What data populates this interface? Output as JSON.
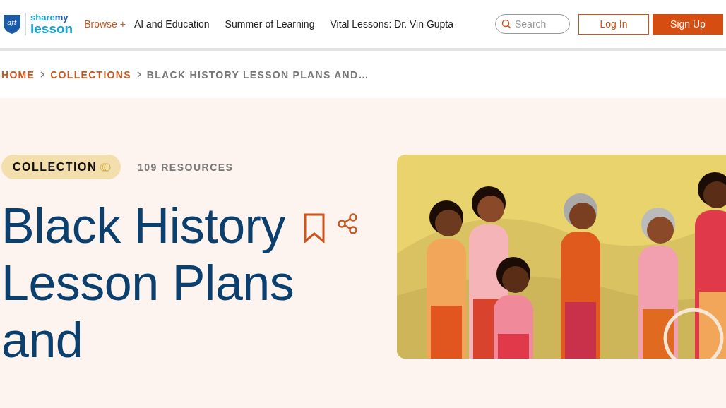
{
  "logo": {
    "line_1": "share",
    "line_1b": "my",
    "line_2": "lesson",
    "badge": "aft"
  },
  "nav": [
    {
      "label": "Browse +",
      "kind": "menu"
    },
    {
      "label": "AI and Education",
      "kind": "link"
    },
    {
      "label": "Summer of Learning",
      "kind": "link"
    },
    {
      "label": "Vital Lessons: Dr. Vin Gupta",
      "kind": "link"
    }
  ],
  "search": {
    "placeholder": "Search"
  },
  "buttons": [
    {
      "label": "Log In",
      "kind": "outline"
    },
    {
      "label": "Sign Up",
      "kind": "filled"
    }
  ],
  "breadcrumb": [
    {
      "label": "HOME",
      "kind": "link"
    },
    {
      "label": "COLLECTIONS",
      "kind": "link"
    },
    {
      "label": "BLACK HISTORY LESSON PLANS AND…",
      "kind": "current"
    }
  ],
  "collection": {
    "tag": "COLLECTION",
    "count": "109 RESOURCES",
    "title": "Black History Lesson Plans and"
  }
}
